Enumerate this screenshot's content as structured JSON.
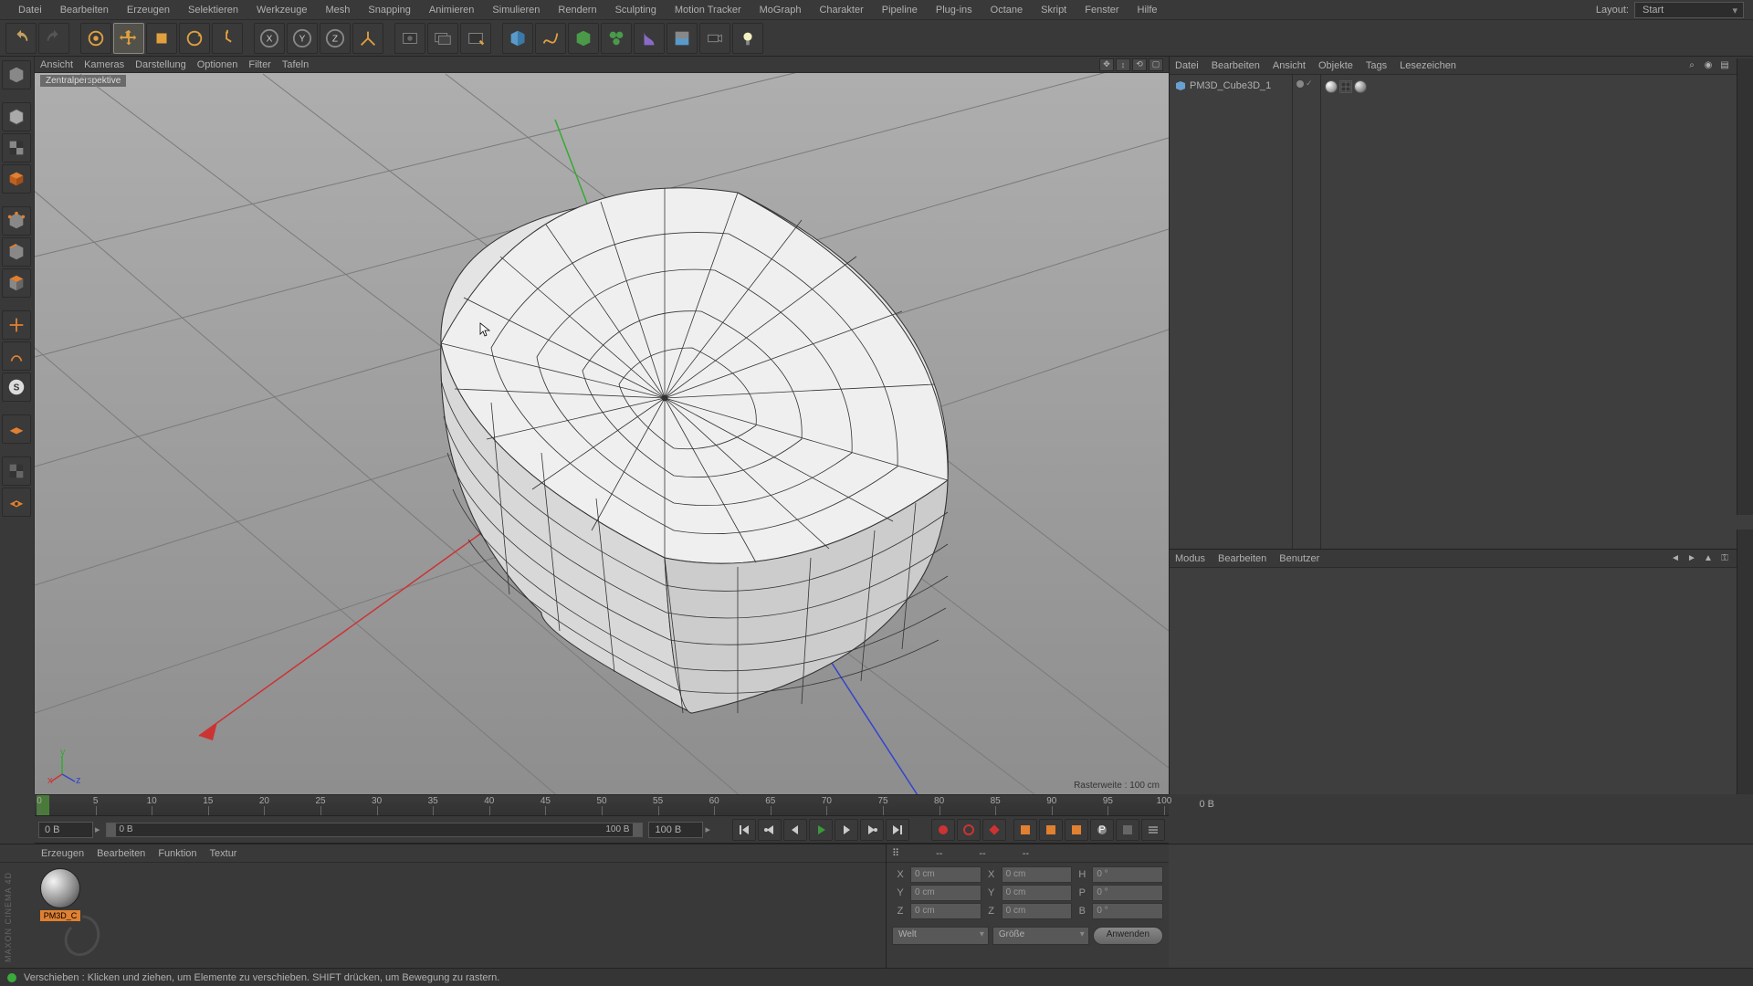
{
  "menubar": [
    "Datei",
    "Bearbeiten",
    "Erzeugen",
    "Selektieren",
    "Werkzeuge",
    "Mesh",
    "Snapping",
    "Animieren",
    "Simulieren",
    "Rendern",
    "Sculpting",
    "Motion Tracker",
    "MoGraph",
    "Charakter",
    "Pipeline",
    "Plug-ins",
    "Octane",
    "Skript",
    "Fenster",
    "Hilfe"
  ],
  "layout": {
    "label": "Layout:",
    "value": "Start"
  },
  "viewport": {
    "menus": [
      "Ansicht",
      "Kameras",
      "Darstellung",
      "Optionen",
      "Filter",
      "Tafeln"
    ],
    "label": "Zentralperspektive",
    "grid_label": "Rasterweite : 100 cm"
  },
  "timeline": {
    "ticks": [
      0,
      5,
      10,
      15,
      20,
      25,
      30,
      35,
      40,
      45,
      50,
      55,
      60,
      65,
      70,
      75,
      80,
      85,
      90,
      95,
      100
    ],
    "start_frame": "0 B",
    "start_frame2": "0 B",
    "end_frame": "100 B",
    "end_frame2": "100 B",
    "current": "0 B"
  },
  "object_panel": {
    "menus": [
      "Datei",
      "Bearbeiten",
      "Ansicht",
      "Objekte",
      "Tags",
      "Lesezeichen"
    ],
    "object_name": "PM3D_Cube3D_1"
  },
  "attr_panel": {
    "menus": [
      "Modus",
      "Bearbeiten",
      "Benutzer"
    ]
  },
  "material_panel": {
    "menus": [
      "Erzeugen",
      "Bearbeiten",
      "Funktion",
      "Textur"
    ],
    "material_name": "PM3D_C"
  },
  "coords": {
    "header": [
      "--",
      "--",
      "--"
    ],
    "rows": [
      {
        "a": "X",
        "av": "0 cm",
        "b": "X",
        "bv": "0 cm",
        "c": "H",
        "cv": "0 °"
      },
      {
        "a": "Y",
        "av": "0 cm",
        "b": "Y",
        "bv": "0 cm",
        "c": "P",
        "cv": "0 °"
      },
      {
        "a": "Z",
        "av": "0 cm",
        "b": "Z",
        "bv": "0 cm",
        "c": "B",
        "cv": "0 °"
      }
    ],
    "select1": "Welt",
    "select2": "Größe",
    "apply": "Anwenden"
  },
  "status": "Verschieben : Klicken und ziehen, um Elemente zu verschieben. SHIFT drücken, um Bewegung zu rastern.",
  "logo_text": "MAXON CINEMA 4D"
}
